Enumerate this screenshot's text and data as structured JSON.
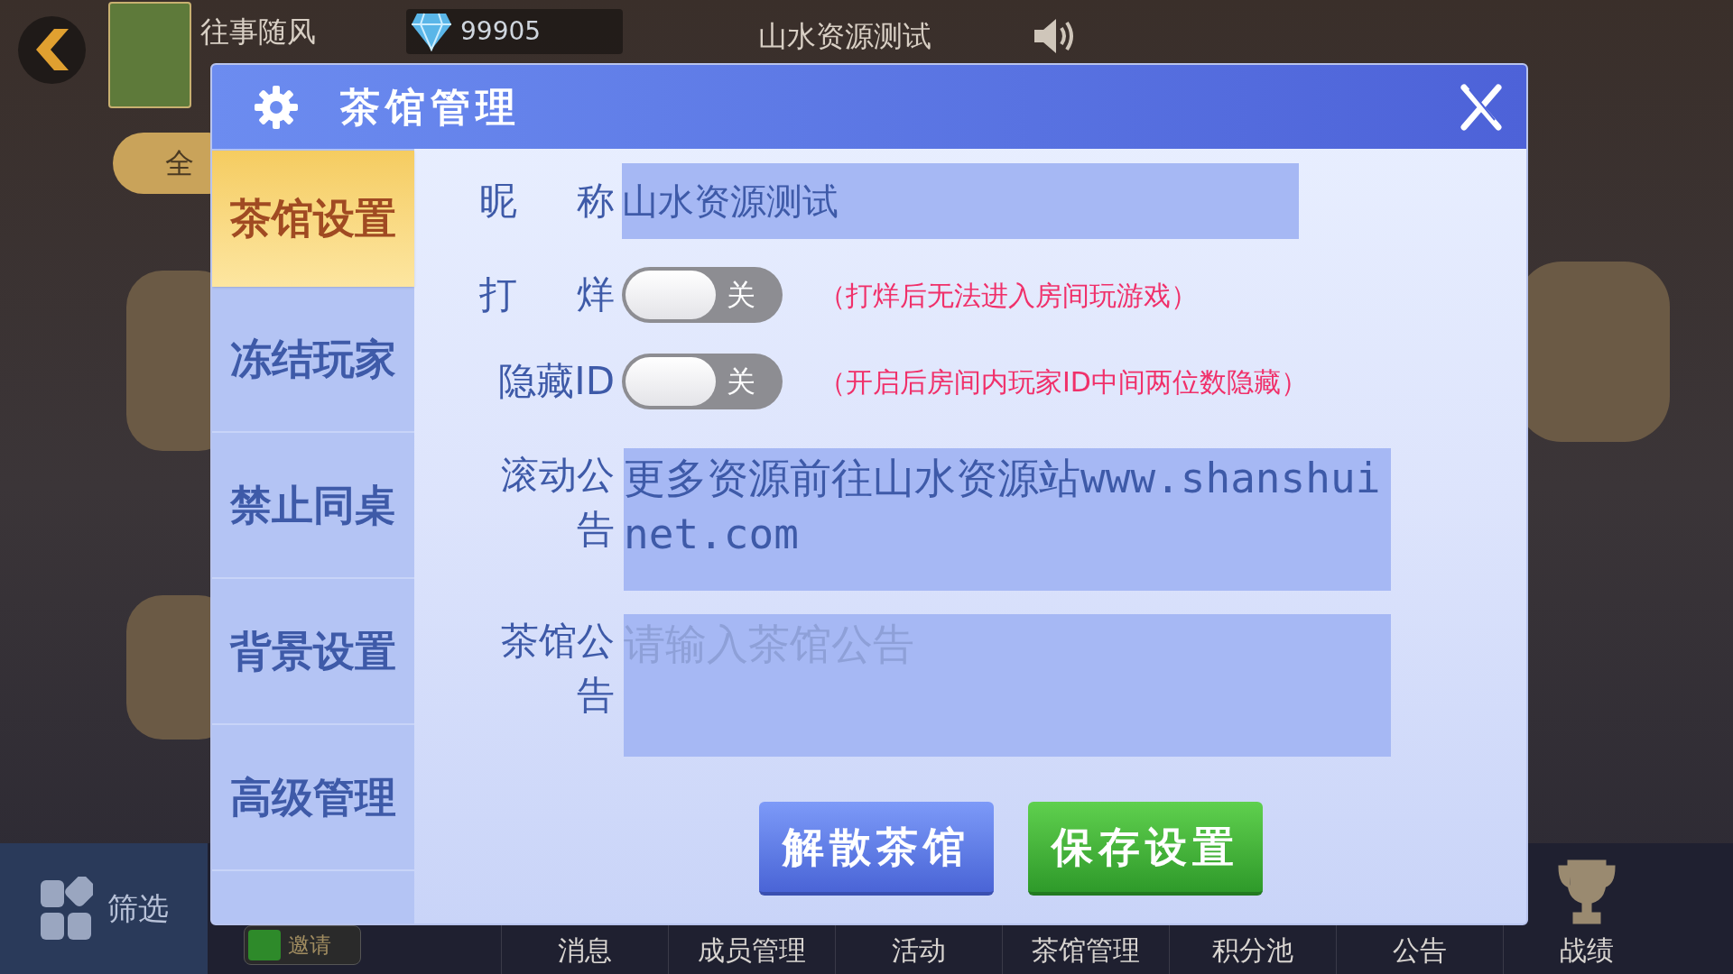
{
  "top_bar": {
    "player_name": "往事随风",
    "diamonds": "99905",
    "room_name": "山水资源测试",
    "filter_tab": "全"
  },
  "dialog": {
    "title": "茶馆管理",
    "sidebar": [
      {
        "label": "茶馆设置",
        "selected": true
      },
      {
        "label": "冻结玩家",
        "selected": false
      },
      {
        "label": "禁止同桌",
        "selected": false
      },
      {
        "label": "背景设置",
        "selected": false
      },
      {
        "label": "高级管理",
        "selected": false
      }
    ],
    "fields": [
      {
        "kind": "text",
        "label": "昵称",
        "value": "山水资源测试"
      },
      {
        "kind": "toggle",
        "label": "打烊",
        "on": false,
        "state_text": "关",
        "note": "（打烊后无法进入房间玩游戏）"
      },
      {
        "kind": "toggle",
        "label": "隐藏ID",
        "on": false,
        "state_text": "关",
        "note": "（开启后房间内玩家ID中间两位数隐藏）"
      },
      {
        "kind": "textarea",
        "label": "滚动公告",
        "value": "更多资源前往山水资源站www.shanshuinet.com"
      },
      {
        "kind": "textarea",
        "label": "茶馆公告",
        "placeholder": "请输入茶馆公告"
      }
    ],
    "buttons": [
      {
        "kind": "danger",
        "label": "解散茶馆"
      },
      {
        "kind": "primary",
        "label": "保存设置"
      }
    ]
  },
  "bottom_bar": {
    "filter_label": "筛选",
    "invite_label": "邀请",
    "items": [
      {
        "label": "消息"
      },
      {
        "label": "成员管理"
      },
      {
        "label": "活动"
      },
      {
        "label": "茶馆管理"
      },
      {
        "label": "积分池"
      },
      {
        "label": "公告"
      },
      {
        "label": "战绩",
        "kind": "trophy"
      }
    ]
  }
}
